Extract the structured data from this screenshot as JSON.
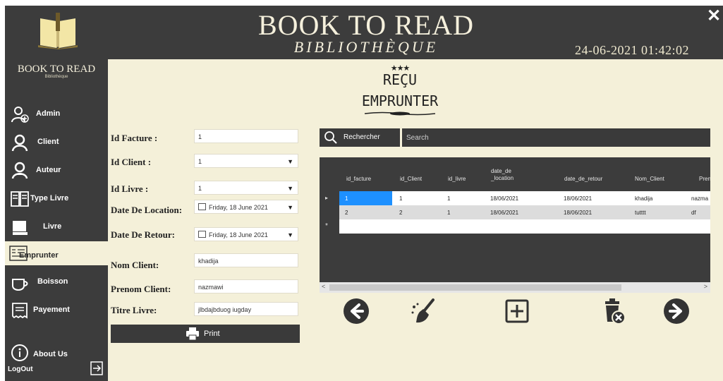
{
  "window": {
    "title": "BOOK TO READ",
    "subtitle": "BIBLIOTHÈQUE",
    "datetime": "24-06-2021 01:42:02",
    "close_label": "✕"
  },
  "brand": {
    "name": "BOOK TO READ",
    "sub": "Bibliothèque"
  },
  "sidebar": {
    "items": [
      {
        "label": "Admin",
        "icon": "add-user-icon"
      },
      {
        "label": "Client",
        "icon": "user-icon"
      },
      {
        "label": "Auteur",
        "icon": "author-icon"
      },
      {
        "label": "Type Livre",
        "icon": "book-types-icon"
      },
      {
        "label": "Livre",
        "icon": "book-icon"
      },
      {
        "label": "Emprunter",
        "icon": "borrow-icon",
        "active": true
      },
      {
        "label": "Boisson",
        "icon": "cup-icon"
      },
      {
        "label": "Payement",
        "icon": "receipt-icon"
      },
      {
        "label": "About Us",
        "icon": "info-icon"
      }
    ],
    "logout": "LogOut"
  },
  "receipt": {
    "stars": "★★★",
    "title": "REÇU",
    "subtitle": "EMPRUNTER"
  },
  "form": {
    "id_facture": {
      "label": "Id Facture :",
      "value": "1"
    },
    "id_client": {
      "label": "Id Client :",
      "value": "1"
    },
    "id_livre": {
      "label": "Id Livre :",
      "value": "1"
    },
    "date_location": {
      "label": "Date De Location:",
      "value": "Friday, 18 June 2021"
    },
    "date_retour": {
      "label": "Date De Retour:",
      "value": "Friday, 18 June 2021"
    },
    "nom_client": {
      "label": "Nom Client:",
      "value": "khadija"
    },
    "prenom_client": {
      "label": "Prenom Client:",
      "value": "nazmawi"
    },
    "titre_livre": {
      "label": "Titre Livre:",
      "value": "jlbdajbduog iugday"
    },
    "print_label": "Print"
  },
  "search": {
    "button_label": "Rechercher",
    "placeholder": "Search"
  },
  "table": {
    "columns": [
      "id_facture",
      "id_Client",
      "id_livre",
      "date_de\n_location",
      "date_de_retour",
      "Nom_Client",
      "Pren"
    ],
    "rows": [
      [
        "1",
        "1",
        "1",
        "18/06/2021",
        "18/06/2021",
        "khadija",
        "nazma"
      ],
      [
        "2",
        "2",
        "1",
        "18/06/2021",
        "18/06/2021",
        "tutttt",
        "df"
      ]
    ],
    "current_row_marker": "▸",
    "new_row_marker": "*"
  },
  "actions": [
    {
      "name": "previous",
      "icon": "arrow-left-icon"
    },
    {
      "name": "clear",
      "icon": "broom-icon"
    },
    {
      "name": "add",
      "icon": "plus-icon"
    },
    {
      "name": "delete",
      "icon": "trash-icon"
    },
    {
      "name": "next",
      "icon": "arrow-right-icon"
    }
  ],
  "colors": {
    "panel": "#3c3c3c",
    "background": "#f4f0d9",
    "selection": "#1e90ff"
  }
}
